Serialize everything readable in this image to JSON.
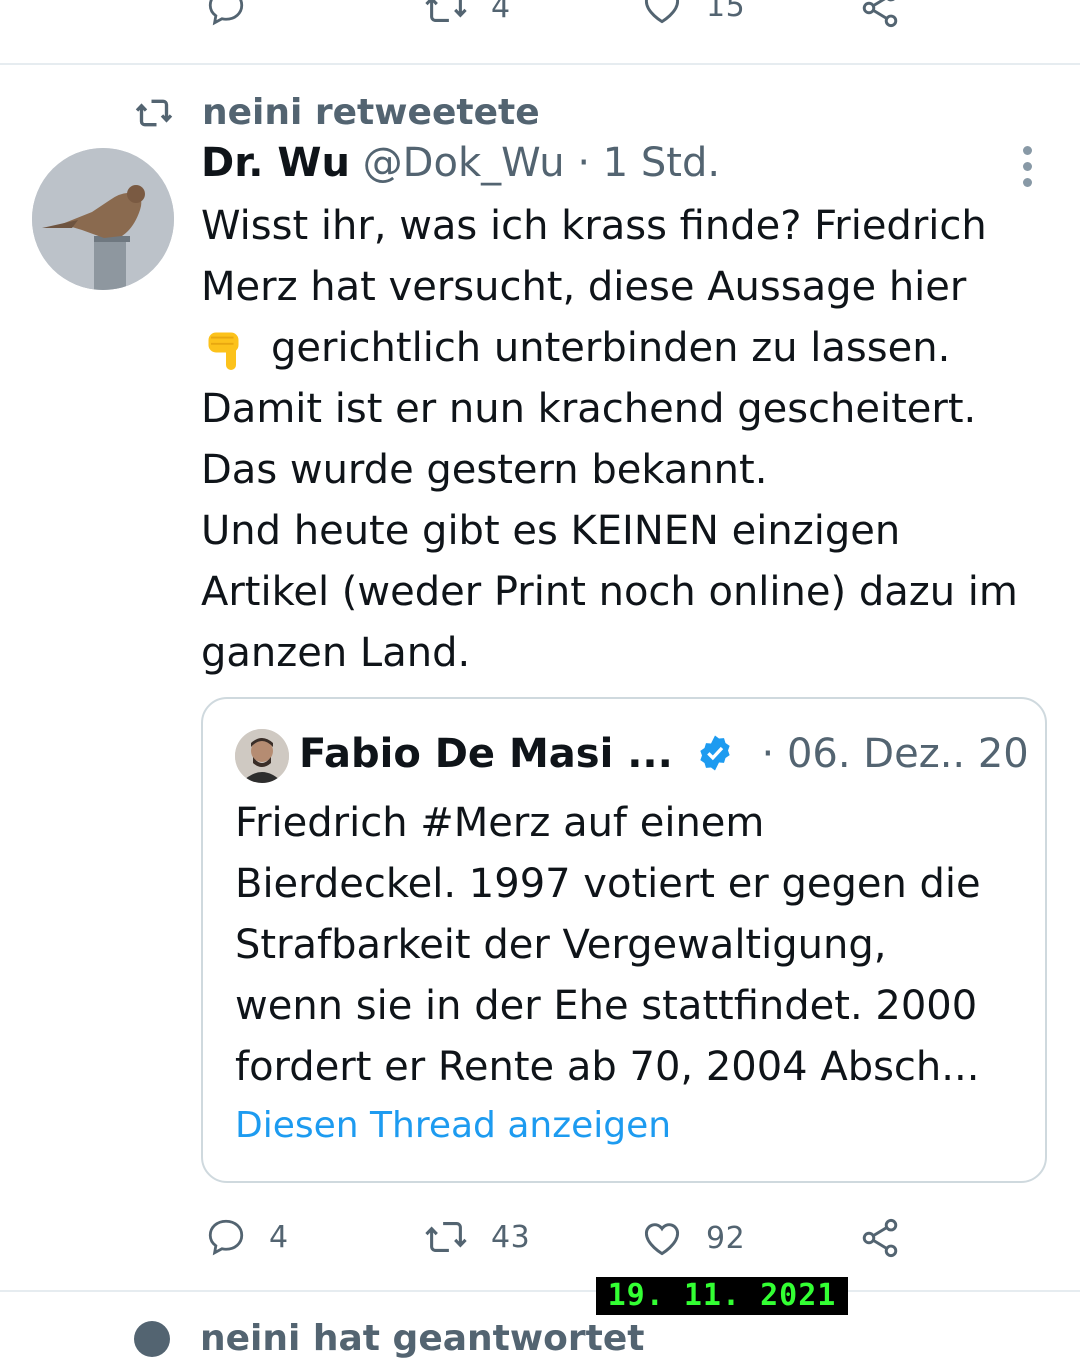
{
  "prev_actions": {
    "reply_count": "",
    "retweet_count": "4",
    "like_count": "15"
  },
  "context": {
    "text": "neini retweetete",
    "icon": "retweet-icon"
  },
  "tweet": {
    "name": "Dr. Wu",
    "handle": "@Dok_Wu",
    "separator": "·",
    "time": "1 Std.",
    "lines": [
      "Wisst ihr, was ich krass finde? Friedrich",
      "Merz hat versucht, diese Aussage hier",
      "gerichtlich unterbinden zu lassen.",
      "Damit ist er nun krachend gescheitert.",
      "Das wurde gestern bekannt.",
      "Und heute gibt es KEINEN einzigen",
      "Artikel (weder Print noch online) dazu im",
      "ganzen Land."
    ],
    "emoji": "backhand-index-pointing-down"
  },
  "quote": {
    "name": "Fabio De Masi ...",
    "separator": "·",
    "date": "06. Dez.. 20",
    "lines": [
      "Friedrich #Merz auf einem",
      "Bierdeckel. 1997 votiert er gegen die",
      "Strafbarkeit der Vergewaltigung,",
      "wenn sie in der Ehe stattfindet. 2000",
      "fordert er Rente ab 70, 2004 Absch..."
    ],
    "link": "Diesen Thread anzeigen"
  },
  "actions": {
    "reply_count": "4",
    "retweet_count": "43",
    "like_count": "92"
  },
  "datestamp": "19. 11. 2021",
  "next_context": {
    "text": "neini hat geantwortet"
  },
  "colors": {
    "muted": "#536471",
    "link": "#1d9bf0",
    "border": "#cfd9de",
    "verified": "#1d9bf0"
  }
}
